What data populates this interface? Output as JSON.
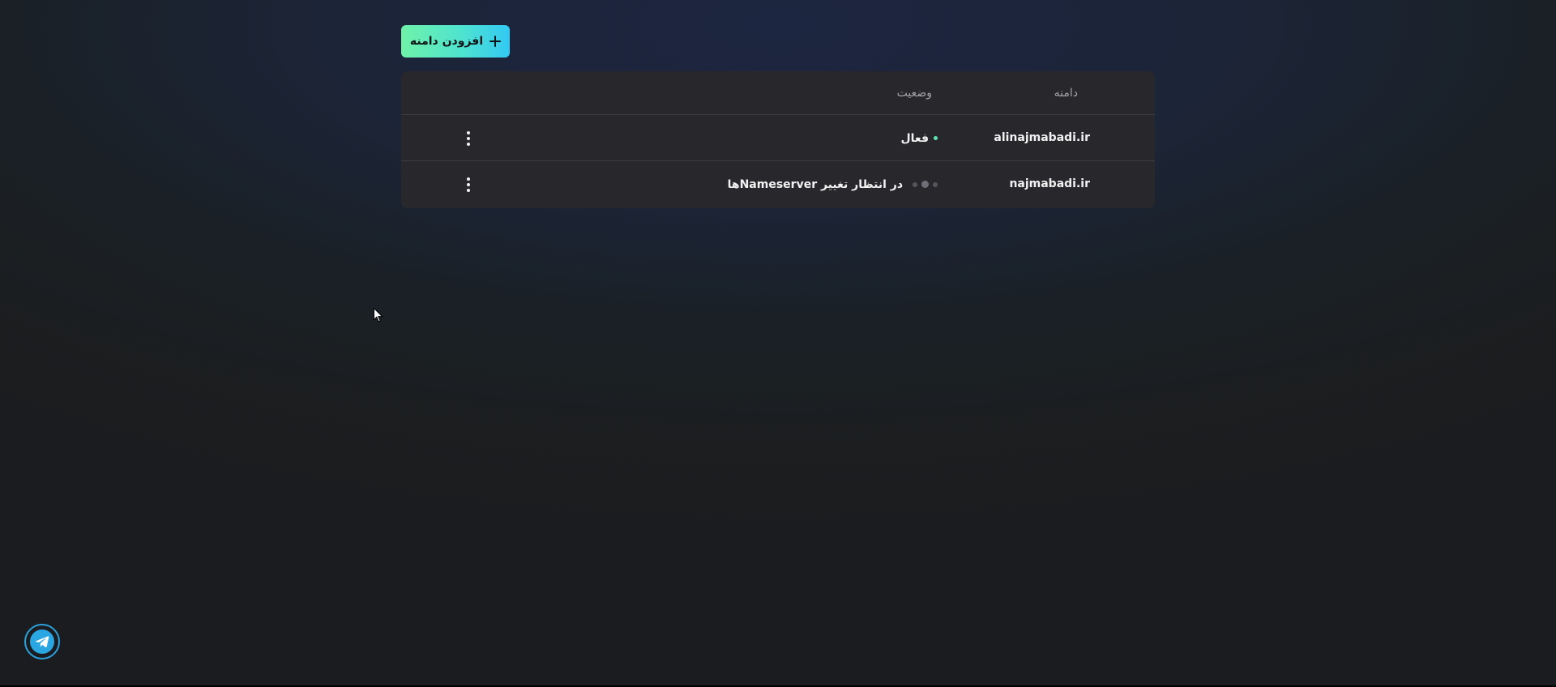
{
  "toolbar": {
    "add_domain_label": "افزودن دامنه"
  },
  "table": {
    "headers": {
      "domain": "دامنه",
      "status": "وضعیت"
    },
    "rows": [
      {
        "domain": "alinajmabadi.ir",
        "status": "فعال",
        "status_kind": "active"
      },
      {
        "domain": "najmabadi.ir",
        "status": "در انتظار تغییر Nameserverها",
        "status_kind": "pending"
      }
    ]
  },
  "icons": {
    "add": "plus-icon",
    "row_menu": "kebab-menu-icon",
    "support": "telegram-icon"
  },
  "colors": {
    "accent_gradient_start": "#6ff2a8",
    "accent_gradient_end": "#32c9f3",
    "active_dot": "#5be6b1",
    "telegram": "#2aa7e3"
  }
}
